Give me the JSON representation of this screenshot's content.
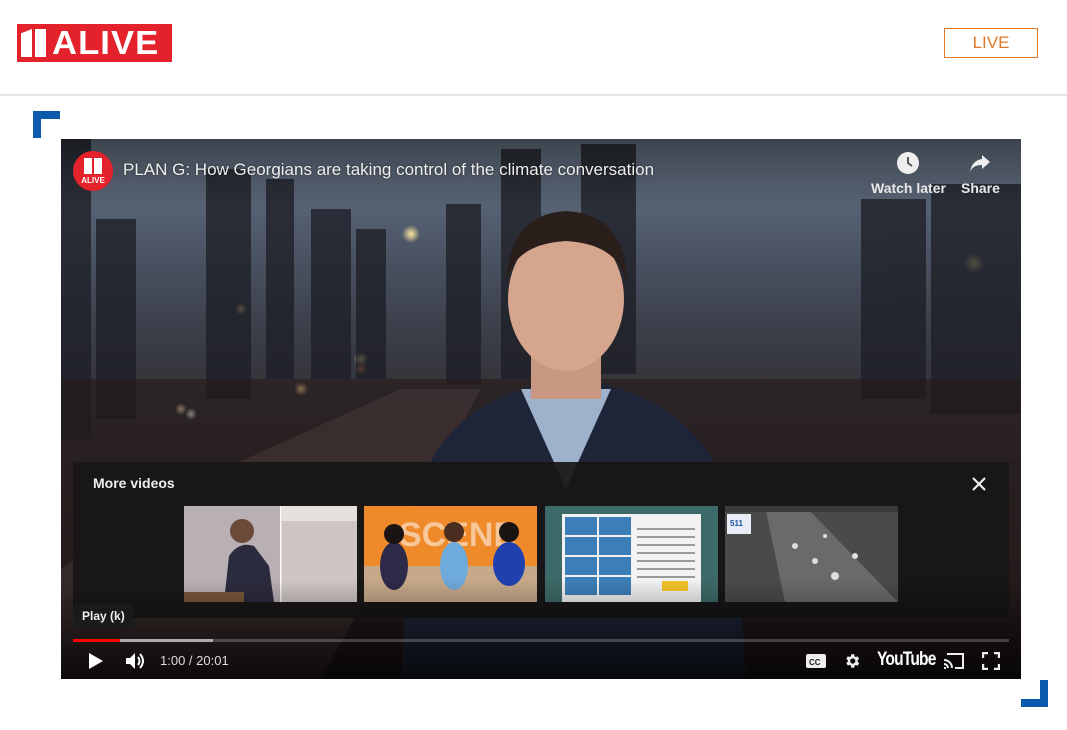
{
  "header": {
    "logo_text": "ALIVE",
    "live_button": "LIVE"
  },
  "colors": {
    "brand_red": "#e3222b",
    "live_orange": "#e07a2a",
    "corner_blue": "#0a5bab",
    "progress_red": "#ff0000"
  },
  "player": {
    "channel_logo_text": "ALIVE",
    "title": "PLAN G: How Georgians are taking control of the climate conversation",
    "actions": [
      {
        "label": "Watch later",
        "icon": "clock-icon"
      },
      {
        "label": "Share",
        "icon": "share-arrow-icon"
      }
    ],
    "more_videos": {
      "title": "More videos",
      "thumbnails": [
        {
          "desc": "Man speaking at podium with microphone"
        },
        {
          "desc": "The Scene - three women on set"
        },
        {
          "desc": "Tweet graphic with photo grid"
        },
        {
          "desc": "Traffic camera - I-75 Chattahoochee River"
        }
      ]
    },
    "tooltip": "Play (k)",
    "progress": {
      "played_fraction": 0.05,
      "buffered_fraction": 0.15
    },
    "time": "1:00 / 20:01",
    "controls": {
      "play": "play-icon",
      "volume": "volume-icon",
      "cc": "cc-icon",
      "settings": "gear-icon",
      "brand": "YouTube",
      "cast": "cast-icon",
      "fullscreen": "fullscreen-icon"
    }
  }
}
